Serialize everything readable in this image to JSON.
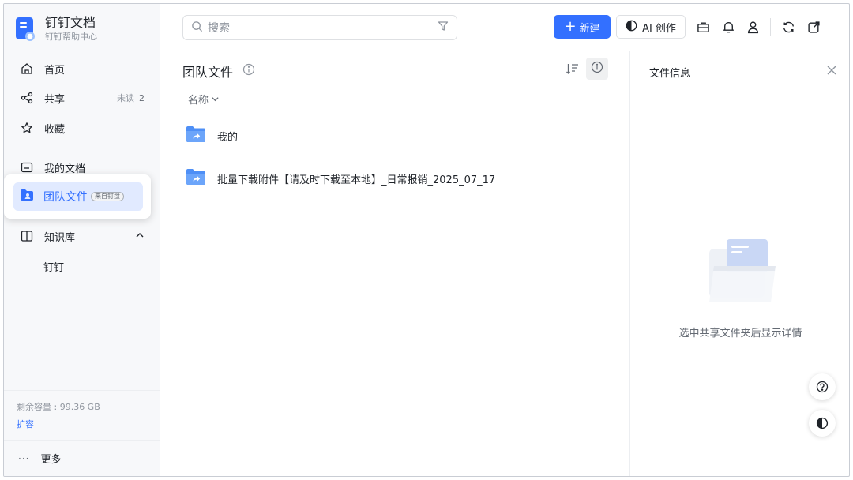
{
  "brand": {
    "title": "钉钉文档",
    "subtitle": "钉钉帮助中心"
  },
  "sidebar": {
    "items": [
      {
        "label": "首页",
        "icon": "home-icon"
      },
      {
        "label": "共享",
        "icon": "share-icon",
        "meta_label": "未读",
        "meta_count": "2"
      },
      {
        "label": "收藏",
        "icon": "star-icon"
      },
      {
        "label": "我的文档",
        "icon": "folder-icon"
      },
      {
        "label": "团队文件",
        "icon": "team-folder-icon",
        "tag": "来自钉盘",
        "active": true
      },
      {
        "label": "知识库",
        "icon": "book-icon"
      }
    ],
    "knowledge_sub": [
      "钉钉"
    ],
    "storage_text": "剩余容量 : 99.36 GB",
    "expand_label": "扩容",
    "more_label": "更多",
    "more_dots": "···"
  },
  "topbar": {
    "search_placeholder": "搜索",
    "new_label": "新建",
    "new_plus": "+",
    "ai_label": "AI 创作",
    "icons": [
      "briefcase-icon",
      "bell-icon",
      "user-icon",
      "sync-icon",
      "external-link-icon"
    ]
  },
  "main": {
    "title": "团队文件",
    "column_name": "名称",
    "files": [
      {
        "name": "我的",
        "type": "shared-folder"
      },
      {
        "name": "批量下载附件【请及时下载至本地】_日常报销_2025_07_17",
        "type": "shared-folder"
      }
    ]
  },
  "details_panel": {
    "title": "文件信息",
    "empty_text": "选中共享文件夹后显示详情"
  },
  "colors": {
    "accent": "#3370ff",
    "active_bg": "#e1eaff",
    "folder": "#4e8ff6"
  }
}
